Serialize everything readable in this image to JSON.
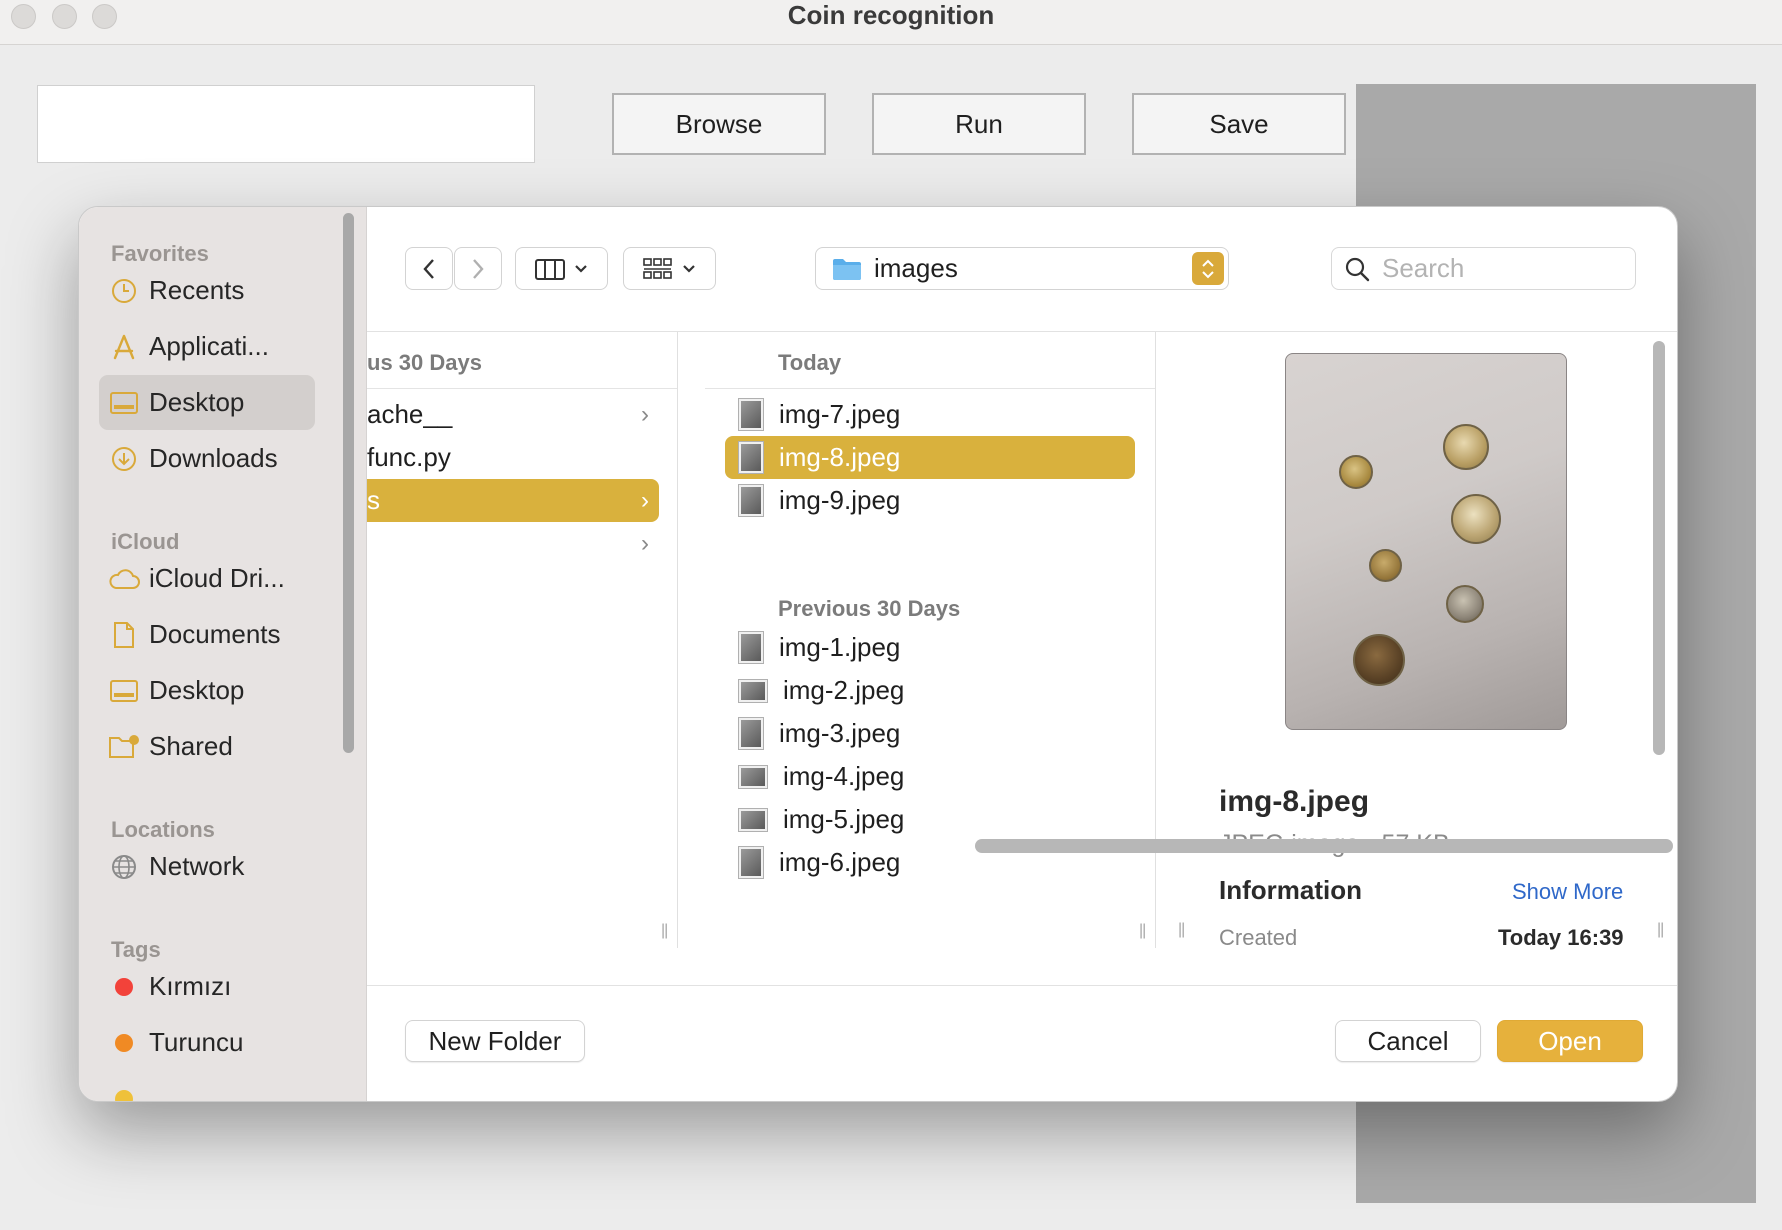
{
  "window": {
    "title": "Coin recognition"
  },
  "app": {
    "path_value": "",
    "browse_label": "Browse",
    "run_label": "Run",
    "save_label": "Save"
  },
  "dialog": {
    "sidebar": {
      "favorites_heading": "Favorites",
      "favorites": [
        {
          "label": "Recents",
          "icon": "clock-icon"
        },
        {
          "label": "Applicati...",
          "icon": "applications-icon"
        },
        {
          "label": "Desktop",
          "icon": "desktop-icon",
          "selected": true
        },
        {
          "label": "Downloads",
          "icon": "download-icon"
        }
      ],
      "icloud_heading": "iCloud",
      "icloud": [
        {
          "label": "iCloud Dri...",
          "icon": "cloud-icon"
        },
        {
          "label": "Documents",
          "icon": "document-icon"
        },
        {
          "label": "Desktop",
          "icon": "desktop-icon"
        },
        {
          "label": "Shared",
          "icon": "shared-folder-icon"
        }
      ],
      "locations_heading": "Locations",
      "locations": [
        {
          "label": "Network",
          "icon": "globe-icon"
        }
      ],
      "tags_heading": "Tags",
      "tags": [
        {
          "label": "Kırmızı",
          "color": "#f2423a"
        },
        {
          "label": "Turuncu",
          "color": "#f08a24"
        }
      ]
    },
    "toolbar": {
      "back_icon": "chevron-left-icon",
      "forward_icon": "chevron-right-icon",
      "view_icon": "columns-view-icon",
      "group_icon": "grid-group-icon",
      "location": "images",
      "search_placeholder": "Search"
    },
    "column1": {
      "heading": "us 30 Days",
      "items": [
        {
          "label": "ache__",
          "folder": true
        },
        {
          "label": "func.py",
          "folder": false
        },
        {
          "label": "s",
          "folder": true,
          "selected": true
        },
        {
          "label": "",
          "folder": true
        }
      ]
    },
    "column2": {
      "today_heading": "Today",
      "today": [
        {
          "label": "img-7.jpeg"
        },
        {
          "label": "img-8.jpeg",
          "selected": true
        },
        {
          "label": "img-9.jpeg"
        }
      ],
      "previous_heading": "Previous 30 Days",
      "previous": [
        {
          "label": "img-1.jpeg"
        },
        {
          "label": "img-2.jpeg"
        },
        {
          "label": "img-3.jpeg"
        },
        {
          "label": "img-4.jpeg"
        },
        {
          "label": "img-5.jpeg"
        },
        {
          "label": "img-6.jpeg"
        }
      ]
    },
    "preview": {
      "name": "img-8.jpeg",
      "kind": "JPEG image - 57 KB",
      "info_heading": "Information",
      "show_more": "Show More",
      "created_label": "Created",
      "created_value": "Today 16:39"
    },
    "footer": {
      "new_folder": "New Folder",
      "cancel": "Cancel",
      "open": "Open"
    }
  },
  "colors": {
    "accent": "#d9b13d",
    "open_button": "#e6b13c",
    "link": "#2f68c9"
  }
}
